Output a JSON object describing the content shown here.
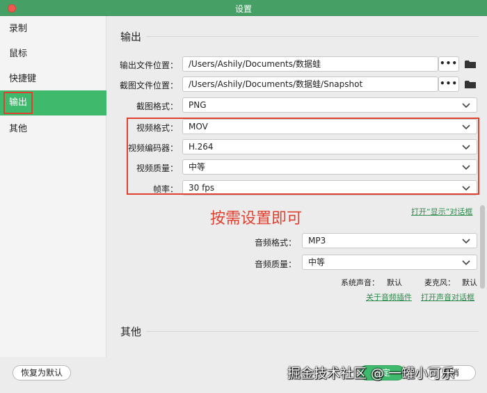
{
  "window": {
    "title": "设置"
  },
  "sidebar": {
    "items": [
      {
        "label": "录制"
      },
      {
        "label": "鼠标"
      },
      {
        "label": "快捷键"
      },
      {
        "label": "输出"
      },
      {
        "label": "其他"
      }
    ]
  },
  "output": {
    "heading": "输出",
    "file_location_label": "输出文件位置：",
    "file_location_value": "/Users/Ashily/Documents/数据蛙",
    "screenshot_location_label": "截图文件位置：",
    "screenshot_location_value": "/Users/Ashily/Documents/数据蛙/Snapshot",
    "browse_label": "•••",
    "screenshot_format_label": "截图格式：",
    "screenshot_format_value": "PNG",
    "video_format_label": "视频格式：",
    "video_format_value": "MOV",
    "video_encoder_label": "视频编码器：",
    "video_encoder_value": "H.264",
    "video_quality_label": "视频质量：",
    "video_quality_value": "中等",
    "frame_rate_label": "帧率：",
    "frame_rate_value": "30 fps",
    "open_display_dialog": "打开“显示”对话框",
    "audio_format_label": "音频格式：",
    "audio_format_value": "MP3",
    "audio_quality_label": "音频质量：",
    "audio_quality_value": "中等",
    "system_sound_label": "系统声音：",
    "system_sound_value": "默认",
    "microphone_label": "麦克风：",
    "microphone_value": "默认",
    "about_audio_plugin": "关于音频插件",
    "open_sound_dialog": "打开声音对话框"
  },
  "annotation": {
    "text": "按需设置即可"
  },
  "other": {
    "heading": "其他"
  },
  "footer": {
    "restore_defaults": "恢复为默认",
    "ok": "确定",
    "cancel": "取消"
  },
  "watermark": "掘金技术社区 @ 一罐小可乐",
  "colors": {
    "accent": "#3fb96c",
    "titlebar": "#46a065",
    "annotation": "#e0402f"
  }
}
